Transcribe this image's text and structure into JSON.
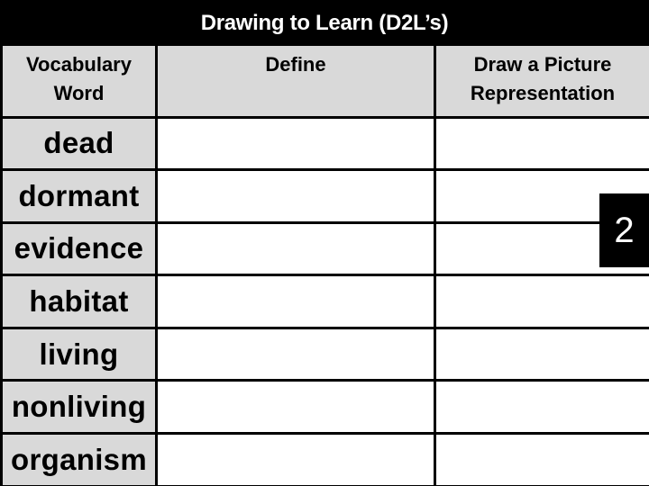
{
  "title": "Drawing to Learn (D2L’s)",
  "table": {
    "headers": [
      "Vocabulary\nWord",
      "Define",
      "Draw a Picture\nRepresentation"
    ],
    "header_lines": {
      "vocab": [
        "Vocabulary",
        "Word"
      ],
      "define": [
        "Define"
      ],
      "draw": [
        "Draw a Picture",
        "Representation"
      ]
    },
    "rows": [
      {
        "word": "dead",
        "define": "",
        "draw": ""
      },
      {
        "word": "dormant",
        "define": "",
        "draw": ""
      },
      {
        "word": "evidence",
        "define": "",
        "draw": ""
      },
      {
        "word": "habitat",
        "define": "",
        "draw": ""
      },
      {
        "word": "living",
        "define": "",
        "draw": ""
      },
      {
        "word": "nonliving",
        "define": "",
        "draw": ""
      },
      {
        "word": "organism",
        "define": "",
        "draw": ""
      }
    ]
  },
  "page_badge": "2",
  "colors": {
    "title_bg": "#000000",
    "title_text": "#ffffff",
    "header_bg": "#d9d9d9",
    "word_bg": "#d9d9d9",
    "border": "#000000",
    "badge_bg": "#000000",
    "badge_text": "#ffffff"
  }
}
